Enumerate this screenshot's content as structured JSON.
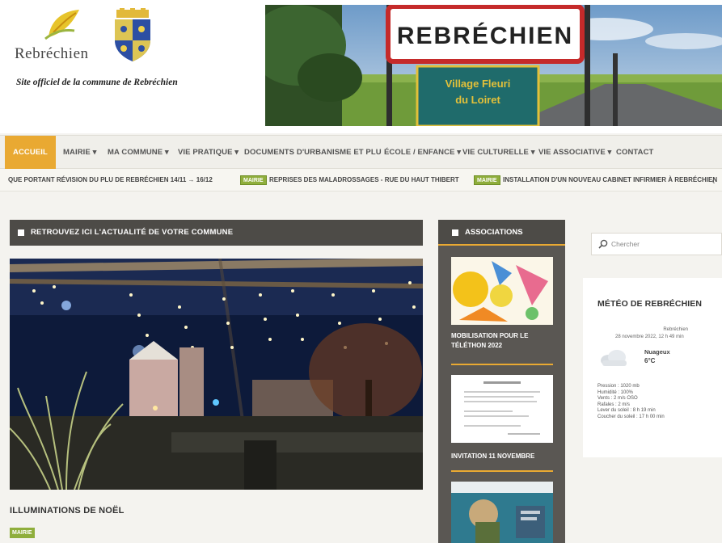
{
  "site": {
    "logo_text": "Rebréchien",
    "tagline": "Site officiel de la commune de Rebréchien",
    "sign_text": "REBRÉCHIEN",
    "sign_sub_1": "Village Fleuri",
    "sign_sub_2": "du Loiret"
  },
  "nav": {
    "items": [
      {
        "label": "ACCUEIL"
      },
      {
        "label": "MAIRIE ▾"
      },
      {
        "label": "MA COMMUNE ▾"
      },
      {
        "label": "VIE PRATIQUE ▾"
      },
      {
        "label": "DOCUMENTS D'URBANISME ET PLU"
      },
      {
        "label": "ÉCOLE / ENFANCE ▾"
      },
      {
        "label": "VIE CULTURELLE ▾"
      },
      {
        "label": "VIE ASSOCIATIVE ▾"
      },
      {
        "label": "CONTACT"
      }
    ]
  },
  "ticker": {
    "items": [
      {
        "text": "QUE PORTANT RÉVISION DU PLU DE REBRÉCHIEN 14/11 → 16/12"
      },
      {
        "badge": "MAIRIE",
        "text": "REPRISES DES MALADROSSAGES - RUE DU HAUT THIBERT"
      },
      {
        "badge": "MAIRIE",
        "text": "INSTALLATION D'UN NOUVEAU CABINET INFIRMIER À REBRÉCHIEN"
      }
    ],
    "arrow": "‹"
  },
  "main": {
    "section_title": "RETROUVEZ ICI L'ACTUALITÉ DE VOTRE COMMUNE",
    "article_title": "ILLUMINATIONS DE NOËL",
    "article_badge": "MAIRIE"
  },
  "associations": {
    "title": "ASSOCIATIONS",
    "items": [
      {
        "caption_1": "MOBILISATION POUR LE",
        "caption_2": "TÉLÉTHON 2022"
      },
      {
        "caption_1": "INVITATION 11 NOVEMBRE",
        "caption_2": ""
      }
    ]
  },
  "sidebar": {
    "search_placeholder": "Chercher",
    "weather": {
      "title": "MÉTÉO DE REBRÉCHIEN",
      "location": "Rebréchien",
      "date": "28 novembre 2022, 12 h 49 min",
      "condition": "Nuageux",
      "temperature": "6°C",
      "details": [
        "Pression : 1020 mb",
        "Humidité : 100%",
        "Vents : 2 m/s OSO",
        "Rafales : 2 m/s",
        "Lever du soleil : 8 h 19 min",
        "Coucher du soleil : 17 h 00 min"
      ]
    }
  },
  "colors": {
    "accent": "#e9a932",
    "badge_green": "#8fae3c",
    "dark_panel": "#4d4b47"
  }
}
